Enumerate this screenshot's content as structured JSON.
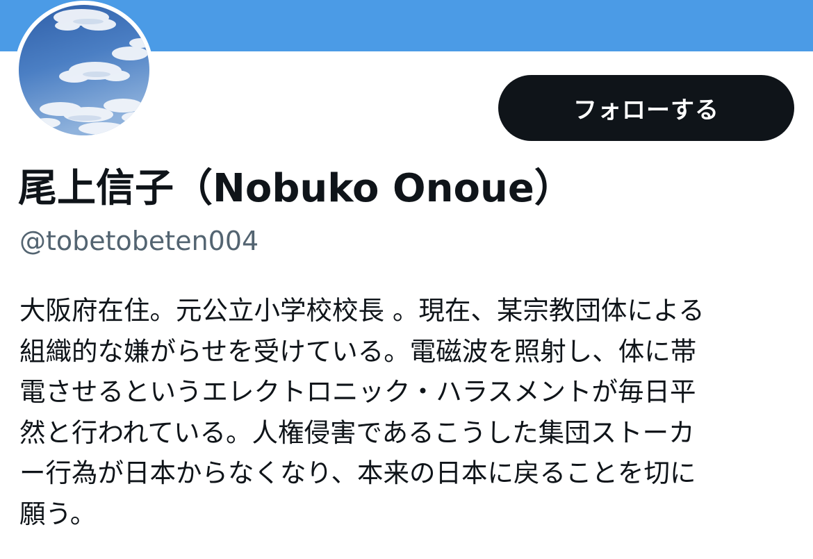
{
  "profile": {
    "display_name": "尾上信子（Nobuko Onoue）",
    "handle": "@tobetobeten004",
    "follow_label": "フォローする",
    "bio_lines": [
      "大阪府在住。元公立小学校校長 。現在、某宗教団体による",
      "組織的な嫌がらせを受けている。電磁波を照射し、体に帯",
      "電させるというエレクトロニック・ハラスメントが毎日平",
      "然と行われている。人権侵害であるこうした集団ストーカ",
      "ー行為が日本からなくなり、本来の日本に戻ることを切に",
      "願う。"
    ]
  },
  "colors": {
    "banner": "#4b9be6",
    "button_bg": "#0f1419",
    "button_text": "#ffffff",
    "text_primary": "#0f1419",
    "text_secondary": "#536471"
  },
  "icons": {
    "avatar": "sky-with-clouds-photo"
  }
}
